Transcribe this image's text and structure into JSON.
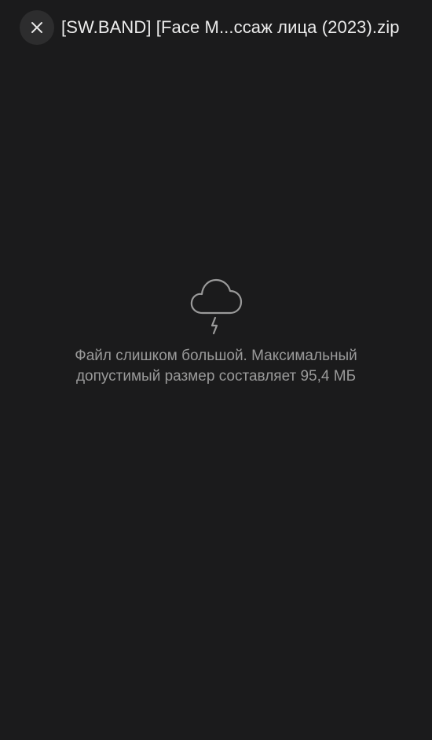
{
  "header": {
    "close_icon": "close-icon",
    "file_name": "[SW.BAND] [Face M...ссаж лица (2023).zip"
  },
  "error": {
    "icon": "storm-cloud-icon",
    "message": "Файл слишком большой. Максимальный допустимый размер составляет 95,4 МБ"
  },
  "colors": {
    "background": "#1b1b1c",
    "close_button_bg": "#2d2d2e",
    "title_text": "#ececec",
    "message_text": "#9a9a9a"
  }
}
